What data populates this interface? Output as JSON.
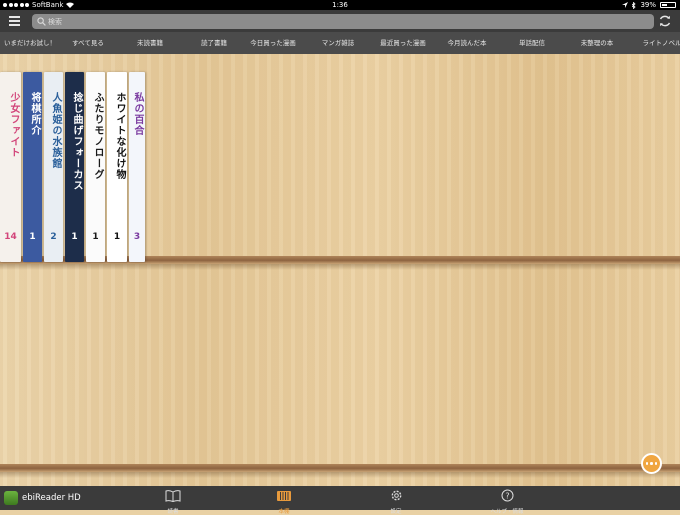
{
  "status_bar": {
    "carrier": "SoftBank",
    "time": "1:36",
    "battery": "39%",
    "battery_level": 0.39
  },
  "search": {
    "placeholder": "検索"
  },
  "tabs": [
    "いまだけお試し！",
    "すべて見る",
    "未読書籍",
    "読了書籍",
    "今日買った漫画",
    "マンガ雑誌",
    "最近買った漫画",
    "今月読んだ本",
    "単話配信",
    "未整理の本",
    "ライトノベル"
  ],
  "books": [
    {
      "title": "少女ファイト",
      "volume": "14",
      "bg": "#f5f1ec",
      "fg": "#d2457a"
    },
    {
      "title": "将棋所介",
      "volume": "1",
      "bg": "#3c5aa0",
      "fg": "#ffffff"
    },
    {
      "title": "人魚姫の水族館",
      "volume": "2",
      "bg": "#e9eef3",
      "fg": "#2a5f9a"
    },
    {
      "title": "捻じ曲げフォーカス",
      "volume": "1",
      "bg": "#1d2d4a",
      "fg": "#ffffff"
    },
    {
      "title": "ふたりモノローグ",
      "volume": "1",
      "bg": "#fbfbfb",
      "fg": "#1a1a1a"
    },
    {
      "title": "ホワイトな化け物",
      "volume": "1",
      "bg": "#ffffff",
      "fg": "#111111"
    },
    {
      "title": "私の百合",
      "volume": "3",
      "bg": "#f3f6fb",
      "fg": "#7a3aa0"
    }
  ],
  "bottom_bar": {
    "app_name": "ebiReader HD",
    "items": [
      {
        "label": "読書",
        "icon": "book-icon",
        "active": false
      },
      {
        "label": "本棚",
        "icon": "bookshelf-icon",
        "active": true
      },
      {
        "label": "設定",
        "icon": "gear-icon",
        "active": false
      },
      {
        "label": "ヘルプ・情報",
        "icon": "help-icon",
        "active": false
      }
    ]
  },
  "colors": {
    "accent": "#f0a640",
    "bar_dark": "#3b3b3b",
    "tab_bar": "#4b4b4b",
    "wood": "#e9d1a4"
  }
}
